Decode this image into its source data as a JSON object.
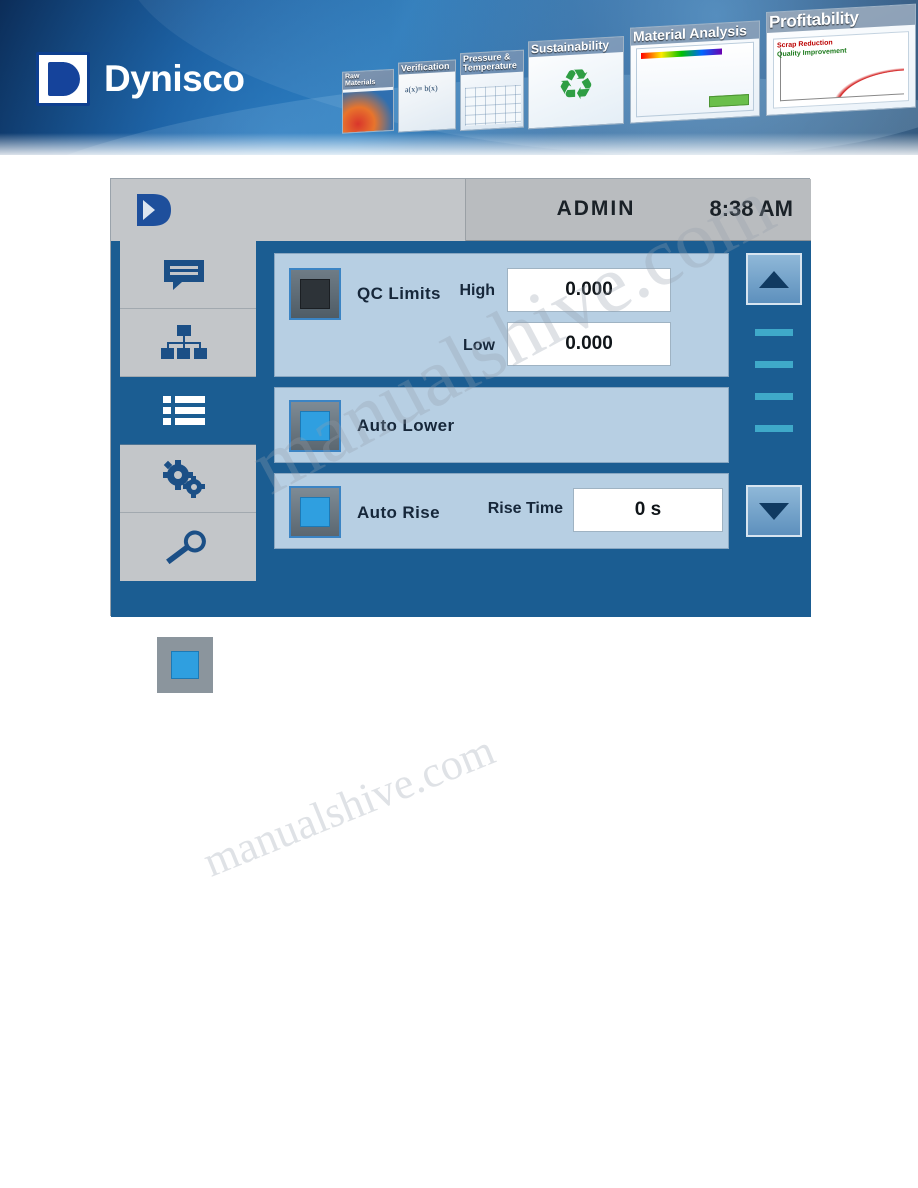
{
  "banner": {
    "brand": "Dynisco",
    "logo_icon": "dynisco-d-logo",
    "thumbnails": [
      {
        "caption": "Raw Materials",
        "icon": "raw-materials-thumb"
      },
      {
        "caption": "Verification",
        "icon": "verification-thumb"
      },
      {
        "caption": "Pressure &\nTemperature",
        "icon": "pressure-temperature-thumb"
      },
      {
        "caption": "Sustainability",
        "icon": "recycle-icon"
      },
      {
        "caption": "Material Analysis",
        "icon": "material-analysis-thumb"
      },
      {
        "caption": "Profitability",
        "icon": "profitability-thumb"
      }
    ],
    "profitability_sub1": "Scrap Reduction",
    "profitability_sub2": "Quality Improvement",
    "verification_formula": "a(x)≡\nb(x)"
  },
  "device": {
    "header": {
      "logo_icon": "dynisco-d-logo",
      "user": "ADMIN",
      "time": "8:38 AM"
    },
    "sidebar": [
      {
        "name": "messages",
        "icon": "speech-bubble-lines-icon",
        "selected": false
      },
      {
        "name": "network",
        "icon": "sitemap-nodes-icon",
        "selected": false
      },
      {
        "name": "list",
        "icon": "bulleted-list-icon",
        "selected": true
      },
      {
        "name": "settings",
        "icon": "gears-icon",
        "selected": false
      },
      {
        "name": "service",
        "icon": "wrench-icon",
        "selected": false
      }
    ],
    "panels": {
      "qc": {
        "label": "QC Limits",
        "checkbox_state": "off",
        "high_label": "High",
        "high_value": "0.000",
        "low_label": "Low",
        "low_value": "0.000"
      },
      "auto_lower": {
        "label": "Auto Lower",
        "checkbox_state": "on"
      },
      "auto_rise": {
        "label": "Auto Rise",
        "checkbox_state": "on",
        "rise_time_label": "Rise Time",
        "rise_time_value": "0 s"
      }
    },
    "scroll": {
      "up_icon": "triangle-up-icon",
      "down_icon": "triangle-down-icon",
      "indicator_count": 4
    }
  },
  "standalone_checkbox": {
    "name": "checkbox-enabled-sample",
    "state": "on"
  },
  "watermark": {
    "line1": "manualshive.com",
    "line2": "manualshive.com"
  }
}
